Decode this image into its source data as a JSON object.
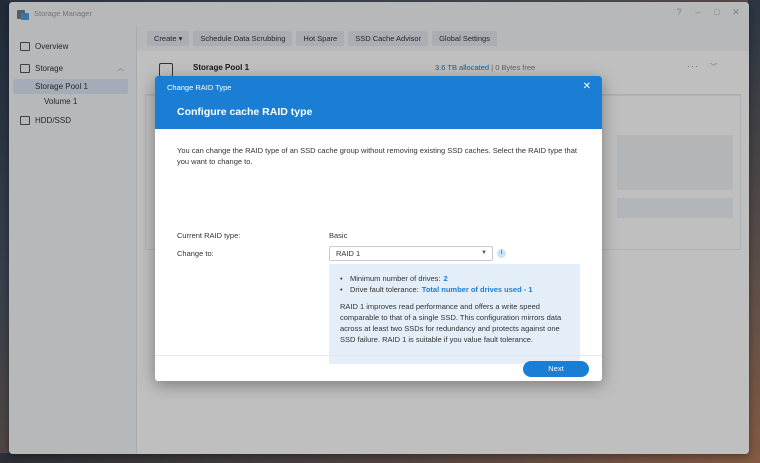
{
  "app": {
    "title": "Storage Manager"
  },
  "window_controls": {
    "help": "?",
    "minimize": "–",
    "maximize": "□",
    "close": "✕"
  },
  "sidebar": {
    "items": [
      {
        "label": "Overview"
      },
      {
        "label": "Storage"
      },
      {
        "label": "Storage Pool 1"
      },
      {
        "label": "Volume 1"
      },
      {
        "label": "HDD/SSD"
      }
    ]
  },
  "toolbar": {
    "buttons": [
      {
        "label": "Create ▾"
      },
      {
        "label": "Schedule Data Scrubbing"
      },
      {
        "label": "Hot Spare"
      },
      {
        "label": "SSD Cache Advisor"
      },
      {
        "label": "Global Settings"
      }
    ]
  },
  "pool": {
    "name": "Storage Pool 1",
    "allocated": "3.6 TB allocated",
    "free": " | 0 Bytes free"
  },
  "dialog": {
    "small_title": "Change RAID Type",
    "title": "Configure cache RAID type",
    "close": "✕",
    "description": "You can change the RAID type of an SSD cache group without removing existing SSD caches. Select the RAID type that you want to change to.",
    "current_label": "Current RAID type:",
    "current_value": "Basic",
    "change_label": "Change to:",
    "selected_option": "RAID 1",
    "info": {
      "min_drives_label": "Minimum number of drives:",
      "min_drives_value": "2",
      "fault_label": "Drive fault tolerance:",
      "fault_value": "Total number of drives used - 1",
      "paragraph": "RAID 1 improves read performance and offers a write speed comparable to that of a single SSD. This configuration mirrors data across at least two SSDs for redundancy and protects against one SSD failure. RAID 1 is suitable if you value fault tolerance."
    },
    "next_label": "Next"
  }
}
